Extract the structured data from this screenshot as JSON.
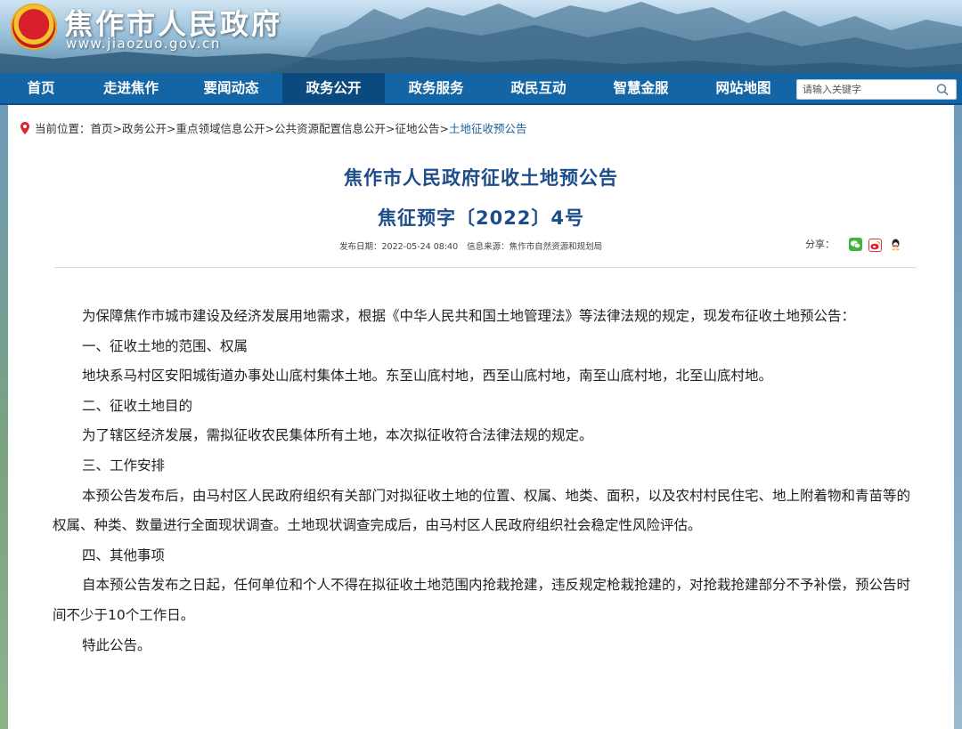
{
  "header": {
    "site_name": "焦作市人民政府",
    "site_url": "www.jiaozuo.gov.cn"
  },
  "nav": {
    "items": [
      {
        "label": "首页",
        "active": false
      },
      {
        "label": "走进焦作",
        "active": false
      },
      {
        "label": "要闻动态",
        "active": false
      },
      {
        "label": "政务公开",
        "active": true
      },
      {
        "label": "政务服务",
        "active": false
      },
      {
        "label": "政民互动",
        "active": false
      },
      {
        "label": "智慧金服",
        "active": false
      },
      {
        "label": "网站地图",
        "active": false
      }
    ],
    "search_placeholder": "请输入关键字"
  },
  "breadcrumb": {
    "prefix": "当前位置：",
    "items": [
      "首页",
      "政务公开",
      "重点领域信息公开",
      "公共资源配置信息公开",
      "征地公告",
      "土地征收预公告"
    ]
  },
  "article": {
    "title": "焦作市人民政府征收土地预公告",
    "subtitle": "焦征预字〔2022〕4号",
    "publish_date": "发布日期：2022-05-24 08:40",
    "source": "信息来源：焦作市自然资源和规划局",
    "share_label": "分享：",
    "paragraphs": [
      "为保障焦作市城市建设及经济发展用地需求，根据《中华人民共和国土地管理法》等法律法规的规定，现发布征收土地预公告：",
      "一、征收土地的范围、权属",
      "地块系马村区安阳城街道办事处山底村集体土地。东至山底村地，西至山底村地，南至山底村地，北至山底村地。",
      "二、征收土地目的",
      "为了辖区经济发展，需拟征收农民集体所有土地，本次拟征收符合法律法规的规定。",
      "三、工作安排",
      "本预公告发布后，由马村区人民政府组织有关部门对拟征收土地的位置、权属、地类、面积，以及农村村民住宅、地上附着物和青苗等的权属、种类、数量进行全面现状调查。土地现状调查完成后，由马村区人民政府组织社会稳定性风险评估。",
      "四、其他事项",
      "自本预公告发布之日起，任何单位和个人不得在拟征收土地范围内抢栽抢建，违反规定枪栽抢建的，对抢栽抢建部分不予补偿，预公告时间不少于10个工作日。",
      "特此公告。"
    ]
  },
  "colors": {
    "nav_bg": "#1365a6",
    "nav_active": "#0b4a7e",
    "title": "#1c4d8a",
    "breadcrumb_current": "#1d5f9a"
  },
  "icons": [
    "location-pin-icon",
    "search-icon",
    "wechat-icon",
    "weibo-icon",
    "qq-icon"
  ]
}
